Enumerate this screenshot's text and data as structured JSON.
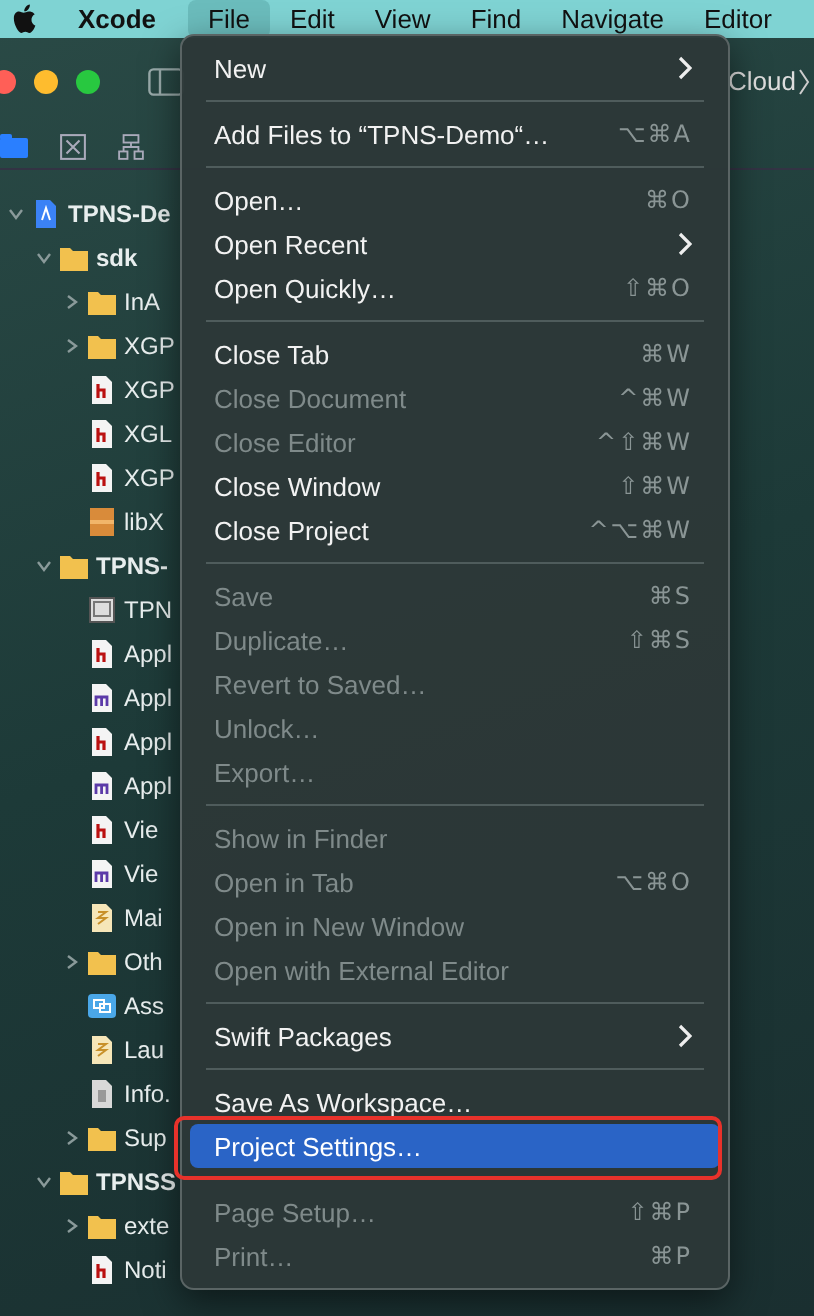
{
  "menu_bar": {
    "app": "Xcode",
    "menus": [
      {
        "label": "File",
        "selected": true
      },
      {
        "label": "Edit",
        "selected": false
      },
      {
        "label": "View",
        "selected": false
      },
      {
        "label": "Find",
        "selected": false
      },
      {
        "label": "Navigate",
        "selected": false
      },
      {
        "label": "Editor",
        "selected": false
      }
    ]
  },
  "toolbar": {
    "breadcrumb": "Cloud"
  },
  "navigator": {
    "tree": [
      {
        "label": "TPNS-De",
        "kind": "project",
        "expanded": true,
        "children": [
          {
            "label": "sdk",
            "kind": "folder",
            "expanded": true,
            "children": [
              {
                "label": "InA",
                "kind": "folder",
                "expanded": false
              },
              {
                "label": "XGP",
                "kind": "folder",
                "expanded": false
              },
              {
                "label": "XGP",
                "kind": "header"
              },
              {
                "label": "XGL",
                "kind": "header"
              },
              {
                "label": "XGP",
                "kind": "header"
              },
              {
                "label": "libX",
                "kind": "library"
              }
            ]
          },
          {
            "label": "TPNS-",
            "kind": "folder",
            "expanded": true,
            "children": [
              {
                "label": "TPN",
                "kind": "entitlements"
              },
              {
                "label": "Appl",
                "kind": "header"
              },
              {
                "label": "Appl",
                "kind": "source"
              },
              {
                "label": "Appl",
                "kind": "header"
              },
              {
                "label": "Appl",
                "kind": "source"
              },
              {
                "label": "Vie",
                "kind": "header"
              },
              {
                "label": "Vie",
                "kind": "source"
              },
              {
                "label": "Mai",
                "kind": "storyboard"
              },
              {
                "label": "Oth",
                "kind": "folder",
                "expanded": false
              },
              {
                "label": "Ass",
                "kind": "assets"
              },
              {
                "label": "Lau",
                "kind": "storyboard"
              },
              {
                "label": "Info.",
                "kind": "plist"
              },
              {
                "label": "Sup",
                "kind": "folder",
                "expanded": false
              }
            ]
          },
          {
            "label": "TPNSS",
            "kind": "folder",
            "expanded": true,
            "children": [
              {
                "label": "exte",
                "kind": "folder",
                "expanded": false
              },
              {
                "label": "Noti",
                "kind": "header"
              }
            ]
          }
        ]
      }
    ]
  },
  "file_menu": [
    {
      "kind": "item",
      "label": "New",
      "submenu": true,
      "disabled": false,
      "selected": false
    },
    {
      "kind": "separator"
    },
    {
      "kind": "item",
      "label": "Add Files to “TPNS-Demo“…",
      "shortcut": "⌥⌘A",
      "disabled": false,
      "selected": false
    },
    {
      "kind": "separator"
    },
    {
      "kind": "item",
      "label": "Open…",
      "shortcut": "⌘O",
      "disabled": false,
      "selected": false
    },
    {
      "kind": "item",
      "label": "Open Recent",
      "submenu": true,
      "disabled": false,
      "selected": false
    },
    {
      "kind": "item",
      "label": "Open Quickly…",
      "shortcut": "⇧⌘O",
      "disabled": false,
      "selected": false
    },
    {
      "kind": "separator"
    },
    {
      "kind": "item",
      "label": "Close Tab",
      "shortcut": "⌘W",
      "disabled": false,
      "selected": false
    },
    {
      "kind": "item",
      "label": "Close Document",
      "shortcut": "^⌘W",
      "disabled": true,
      "selected": false
    },
    {
      "kind": "item",
      "label": "Close Editor",
      "shortcut": "^⇧⌘W",
      "disabled": true,
      "selected": false
    },
    {
      "kind": "item",
      "label": "Close Window",
      "shortcut": "⇧⌘W",
      "disabled": false,
      "selected": false
    },
    {
      "kind": "item",
      "label": "Close Project",
      "shortcut": "^⌥⌘W",
      "disabled": false,
      "selected": false
    },
    {
      "kind": "separator"
    },
    {
      "kind": "item",
      "label": "Save",
      "shortcut": "⌘S",
      "disabled": true,
      "selected": false
    },
    {
      "kind": "item",
      "label": "Duplicate…",
      "shortcut": "⇧⌘S",
      "disabled": true,
      "selected": false
    },
    {
      "kind": "item",
      "label": "Revert to Saved…",
      "disabled": true,
      "selected": false
    },
    {
      "kind": "item",
      "label": "Unlock…",
      "disabled": true,
      "selected": false
    },
    {
      "kind": "item",
      "label": "Export…",
      "disabled": true,
      "selected": false
    },
    {
      "kind": "separator"
    },
    {
      "kind": "item",
      "label": "Show in Finder",
      "disabled": true,
      "selected": false
    },
    {
      "kind": "item",
      "label": "Open in Tab",
      "shortcut": "⌥⌘O",
      "disabled": true,
      "selected": false
    },
    {
      "kind": "item",
      "label": "Open in New Window",
      "disabled": true,
      "selected": false
    },
    {
      "kind": "item",
      "label": "Open with External Editor",
      "disabled": true,
      "selected": false
    },
    {
      "kind": "separator"
    },
    {
      "kind": "item",
      "label": "Swift Packages",
      "submenu": true,
      "disabled": false,
      "selected": false
    },
    {
      "kind": "separator"
    },
    {
      "kind": "item",
      "label": "Save As Workspace…",
      "disabled": false,
      "selected": false
    },
    {
      "kind": "item",
      "label": "Project Settings…",
      "disabled": false,
      "selected": true,
      "outlined": true
    },
    {
      "kind": "separator"
    },
    {
      "kind": "item",
      "label": "Page Setup…",
      "shortcut": "⇧⌘P",
      "disabled": true,
      "selected": false
    },
    {
      "kind": "item",
      "label": "Print…",
      "shortcut": "⌘P",
      "disabled": true,
      "selected": false
    }
  ]
}
